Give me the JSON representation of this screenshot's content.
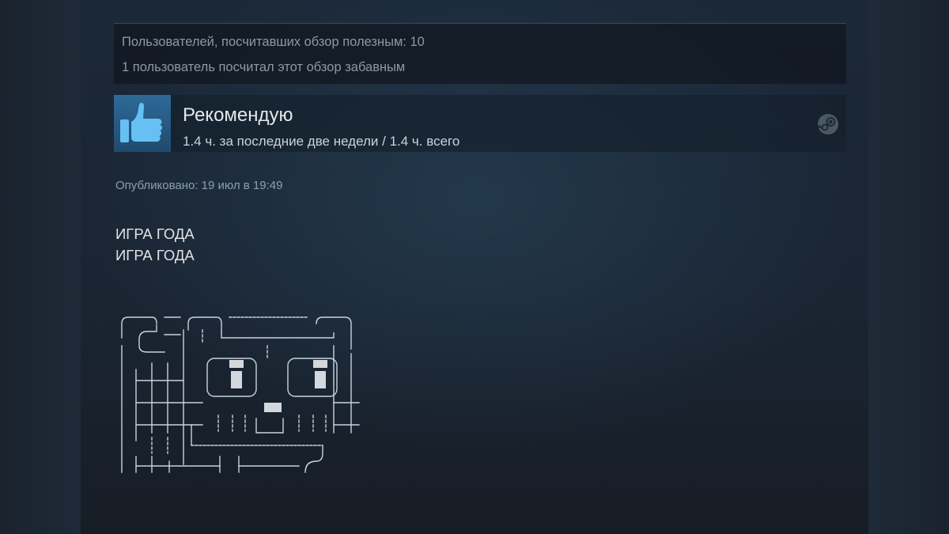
{
  "review": {
    "helpful_votes": "Пользователей, посчитавших обзор полезным: 10",
    "funny_votes": "1 пользователь посчитал этот обзор забавным",
    "recommendation": "Рекомендую",
    "hours": "1.4 ч. за последние две недели / 1.4 ч. всего",
    "posted": "Опубликовано: 19 июл в 19:49",
    "body_lines": [
      "ИГРА ГОДА",
      "ИГРА ГОДА"
    ]
  },
  "icons": {
    "recommend": "thumbs-up-icon",
    "platform": "steam-icon"
  },
  "colors": {
    "background": "#1b2838",
    "thumb_bg": "#2a6592",
    "thumb_icon": "#66c0f4",
    "secondary_text": "#8f98a0",
    "primary_text": "#e4e8ec"
  }
}
